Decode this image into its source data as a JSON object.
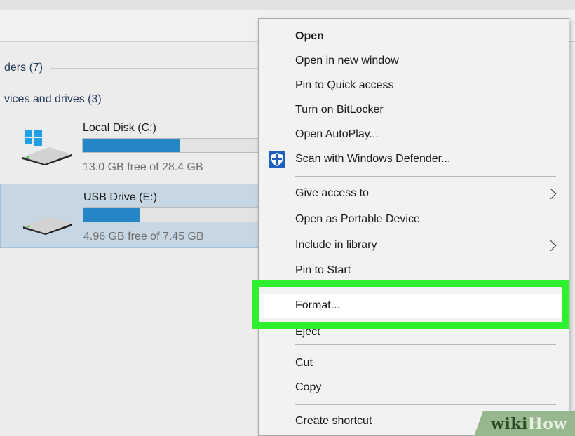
{
  "explorer": {
    "groups": {
      "folders": "ders (7)",
      "devices": "vices and drives (3)"
    },
    "drives": [
      {
        "name": "Local Disk (C:)",
        "free_text": "13.0 GB free of 28.4 GB",
        "used_fraction": 0.54,
        "icon": "local-disk-windows-icon",
        "selected": false
      },
      {
        "name": "USB Drive (E:)",
        "free_text": "4.96 GB free of 7.45 GB",
        "used_fraction": 0.31,
        "icon": "usb-drive-icon",
        "selected": true
      }
    ]
  },
  "context_menu": {
    "items": [
      {
        "label": "Open",
        "bold": true
      },
      {
        "label": "Open in new window"
      },
      {
        "label": "Pin to Quick access"
      },
      {
        "label": "Turn on BitLocker"
      },
      {
        "label": "Open AutoPlay..."
      },
      {
        "label": "Scan with Windows Defender...",
        "icon": "windows-defender-shield-icon"
      },
      {
        "label": "Give access to",
        "submenu": true
      },
      {
        "label": "Open as Portable Device"
      },
      {
        "label": "Include in library",
        "submenu": true
      },
      {
        "label": "Pin to Start"
      },
      {
        "label": "Format...",
        "highlighted": true
      },
      {
        "label": "Eject"
      },
      {
        "label": "Cut"
      },
      {
        "label": "Copy"
      },
      {
        "label": "Create shortcut"
      }
    ]
  },
  "colors": {
    "highlight": "#2ef02e",
    "drive_bar_fill": "#2586c5",
    "selection": "#c6d7e3"
  },
  "watermark": {
    "part1": "wiki",
    "part2": "How"
  }
}
